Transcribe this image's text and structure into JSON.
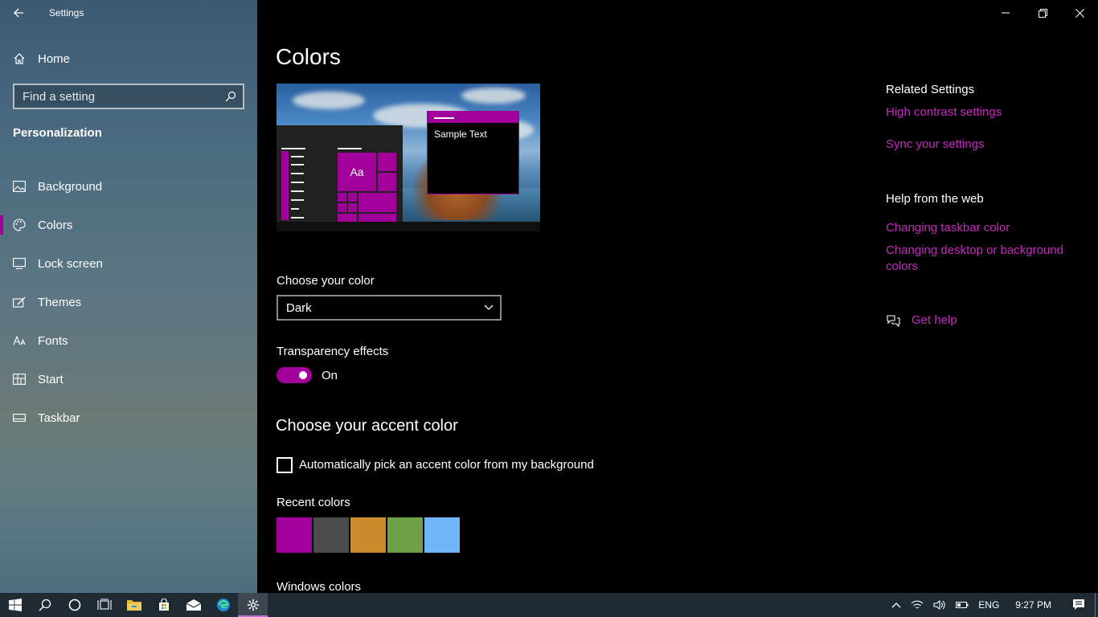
{
  "app": {
    "title": "Settings"
  },
  "sidebar": {
    "home_label": "Home",
    "search_placeholder": "Find a setting",
    "section_title": "Personalization",
    "items": [
      {
        "label": "Background",
        "icon": "picture-icon"
      },
      {
        "label": "Colors",
        "icon": "palette-icon",
        "selected": true
      },
      {
        "label": "Lock screen",
        "icon": "lock-screen-icon"
      },
      {
        "label": "Themes",
        "icon": "brush-icon"
      },
      {
        "label": "Fonts",
        "icon": "fonts-icon"
      },
      {
        "label": "Start",
        "icon": "start-icon"
      },
      {
        "label": "Taskbar",
        "icon": "taskbar-icon"
      }
    ]
  },
  "main": {
    "title": "Colors",
    "preview_sample_text": "Sample Text",
    "preview_tile_text": "Aa",
    "choose_color_label": "Choose your color",
    "choose_color_value": "Dark",
    "transparency_label": "Transparency effects",
    "transparency_state": "On",
    "accent_heading": "Choose your accent color",
    "auto_accent_label": "Automatically pick an accent color from my background",
    "recent_colors_label": "Recent colors",
    "recent_colors": [
      "#a1009b",
      "#4c4c4c",
      "#ce8b2e",
      "#70a046",
      "#6fb6f9"
    ],
    "windows_colors_label": "Windows colors"
  },
  "related": {
    "heading": "Related Settings",
    "links": [
      "High contrast settings",
      "Sync your settings"
    ],
    "help_heading": "Help from the web",
    "help_links": [
      "Changing taskbar color",
      "Changing desktop or background colors"
    ],
    "get_help": "Get help"
  },
  "taskbar": {
    "language": "ENG",
    "time": "9:27 PM"
  },
  "colors": {
    "accent": "#a1009b",
    "link": "#c42bbd"
  }
}
